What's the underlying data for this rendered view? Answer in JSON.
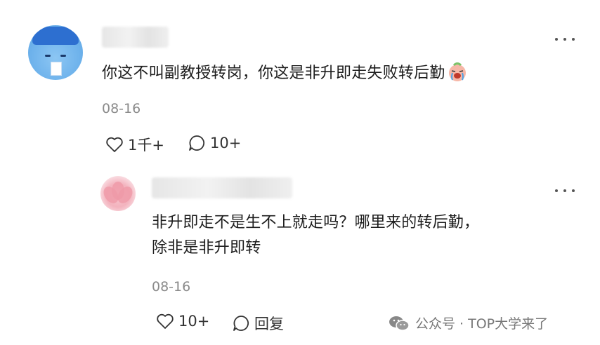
{
  "comment": {
    "text": "你这不叫副教授转岗，你这是非升即走失败转后勤",
    "emoji_icon": "crying-face-emoji",
    "date": "08-16",
    "likes": "1千+",
    "replies": "10+"
  },
  "reply": {
    "text_line1": "非升即走不是生不上就走吗？哪里来的转后勤，",
    "text_line2": "除非是非升即转",
    "date": "08-16",
    "likes": "10+",
    "reply_label": "回复"
  },
  "watermark": {
    "text": "公众号 · TOP大学来了",
    "icon": "wechat-icon"
  }
}
